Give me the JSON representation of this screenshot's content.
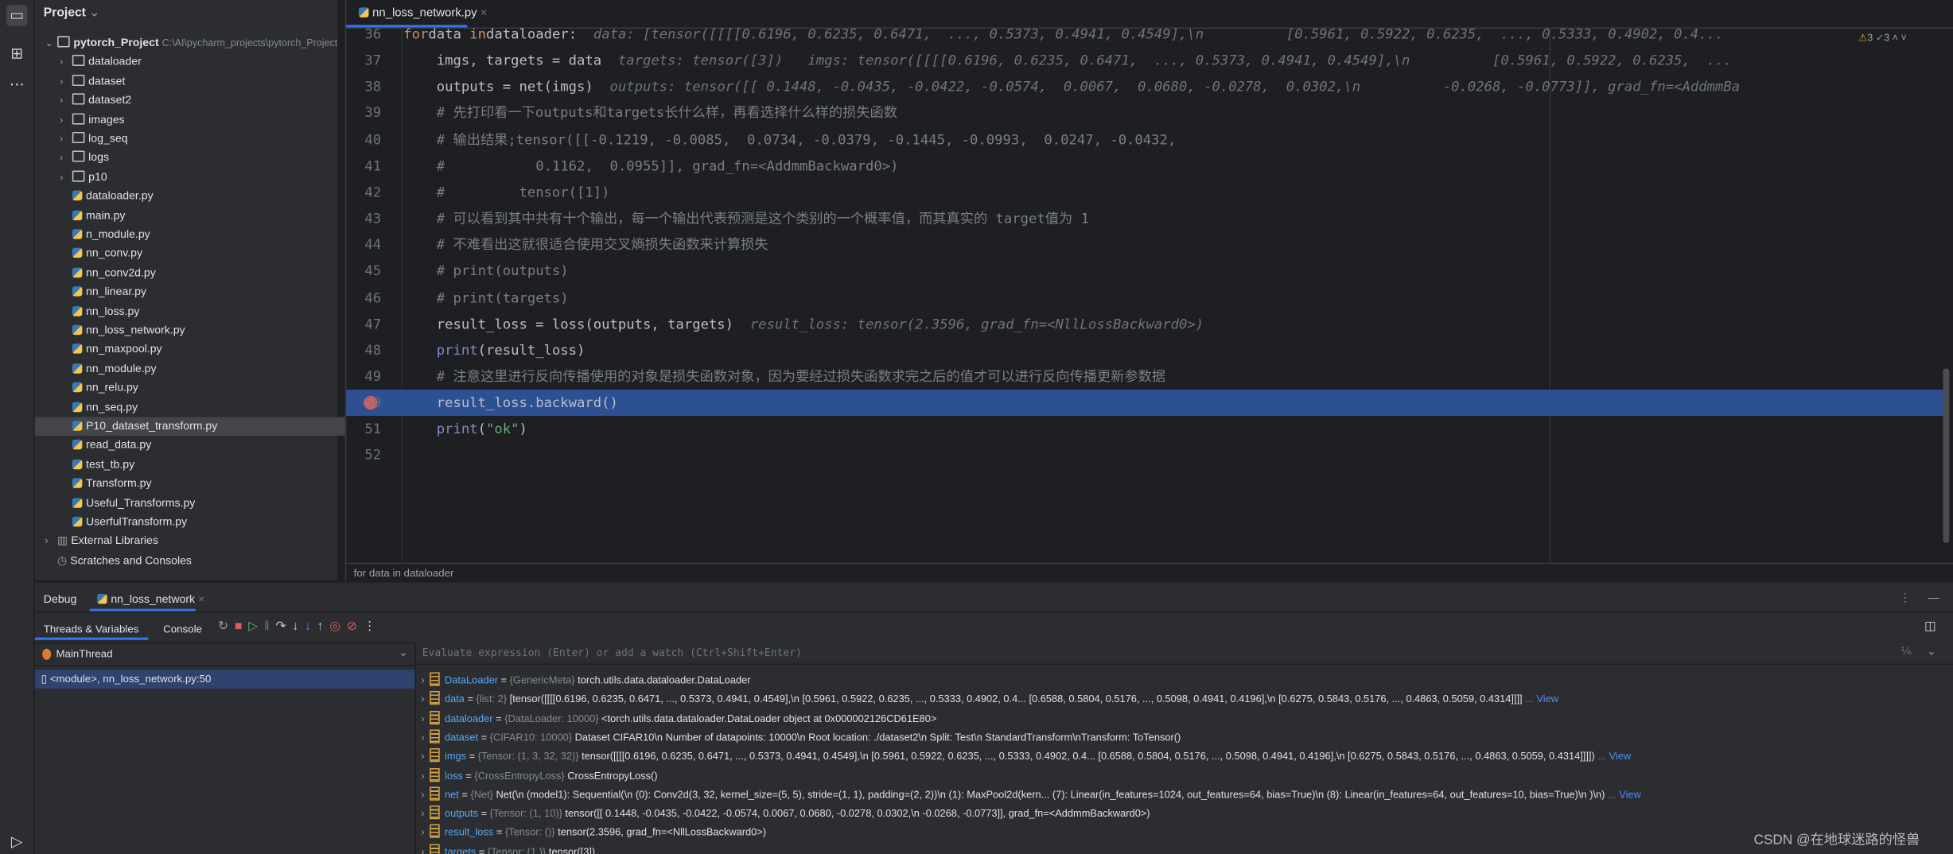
{
  "project": {
    "title": "Project",
    "root": "pytorch_Project",
    "root_path": "C:\\AI\\pycharm_projects\\pytorch_Project",
    "folders": [
      "dataloader",
      "dataset",
      "dataset2",
      "images",
      "log_seq",
      "logs",
      "p10"
    ],
    "files": [
      "dataloader.py",
      "main.py",
      "n_module.py",
      "nn_conv.py",
      "nn_conv2d.py",
      "nn_linear.py",
      "nn_loss.py",
      "nn_loss_network.py",
      "nn_maxpool.py",
      "nn_module.py",
      "nn_relu.py",
      "nn_seq.py",
      "P10_dataset_transform.py",
      "read_data.py",
      "test_tb.py",
      "Transform.py",
      "Useful_Transforms.py",
      "UserfulTransform.py"
    ],
    "selected": "P10_dataset_transform.py",
    "extra": [
      "External Libraries",
      "Scratches and Consoles"
    ]
  },
  "editor": {
    "tab": "nn_loss_network.py",
    "breadcrumb": "for data in dataloader",
    "inspections": {
      "warnings": "3",
      "ok": "3"
    },
    "current_line": 50,
    "breakpoint_line": 50,
    "lines": [
      {
        "n": "36",
        "seg": [
          [
            "kw",
            "for"
          ],
          [
            "",
            "data "
          ],
          [
            "kw",
            "in"
          ],
          [
            "",
            "dataloader:"
          ],
          [
            "hint",
            "  data: [tensor([[[[0.6196, 0.6235, 0.6471,  ..., 0.5373, 0.4941, 0.4549],\\n          [0.5961, 0.5922, 0.6235,  ..., 0.5333, 0.4902, 0.4..."
          ]
        ]
      },
      {
        "n": "37",
        "seg": [
          [
            "",
            "    imgs, targets = data"
          ],
          [
            "hint",
            "  targets: tensor([3])   imgs: tensor([[[[0.6196, 0.6235, 0.6471,  ..., 0.5373, 0.4941, 0.4549],\\n          [0.5961, 0.5922, 0.6235,  ..."
          ]
        ]
      },
      {
        "n": "38",
        "seg": [
          [
            "",
            "    outputs = net(imgs)"
          ],
          [
            "hint",
            "  outputs: tensor([[ 0.1448, -0.0435, -0.0422, -0.0574,  0.0067,  0.0680, -0.0278,  0.0302,\\n          -0.0268, -0.0773]], grad_fn=<AddmmBa"
          ]
        ]
      },
      {
        "n": "39",
        "seg": [
          [
            "cm",
            "    # 先打印看一下outputs和targets长什么样，再看选择什么样的损失函数"
          ]
        ]
      },
      {
        "n": "40",
        "seg": [
          [
            "cm",
            "    # 输出结果;tensor([[-0.1219, -0.0085,  0.0734, -0.0379, -0.1445, -0.0993,  0.0247, -0.0432,"
          ]
        ]
      },
      {
        "n": "41",
        "seg": [
          [
            "cm",
            "    #           0.1162,  0.0955]], grad_fn=<AddmmBackward0>)"
          ]
        ]
      },
      {
        "n": "42",
        "seg": [
          [
            "cm",
            "    #         tensor([1])"
          ]
        ]
      },
      {
        "n": "43",
        "seg": [
          [
            "cm",
            "    # 可以看到其中共有十个输出，每一个输出代表预测是这个类别的一个概率值，而其真实的 target值为 1"
          ]
        ]
      },
      {
        "n": "44",
        "seg": [
          [
            "cm",
            "    # 不难看出这就很适合使用交叉熵损失函数来计算损失"
          ]
        ]
      },
      {
        "n": "45",
        "seg": [
          [
            "cm",
            "    # print(outputs)"
          ]
        ]
      },
      {
        "n": "46",
        "seg": [
          [
            "cm",
            "    # print(targets)"
          ]
        ]
      },
      {
        "n": "47",
        "seg": [
          [
            "",
            "    result_loss = loss(outputs, targets)"
          ],
          [
            "hint",
            "  result_loss: tensor(2.3596, grad_fn=<NllLossBackward0>)"
          ]
        ]
      },
      {
        "n": "48",
        "seg": [
          [
            "bi",
            "    print"
          ],
          [
            "",
            "(result_loss)"
          ]
        ]
      },
      {
        "n": "49",
        "seg": [
          [
            "cm",
            "    # 注意这里进行反向传播使用的对象是损失函数对象，因为要经过损失函数求完之后的值才可以进行反向传播更新参数据"
          ]
        ]
      },
      {
        "n": "50",
        "seg": [
          [
            "",
            "    result_loss.backward()"
          ]
        ]
      },
      {
        "n": "51",
        "seg": [
          [
            "bi",
            "    print"
          ],
          [
            "",
            "("
          ],
          [
            "st",
            "\"ok\""
          ],
          [
            "",
            ")"
          ]
        ]
      },
      {
        "n": "52",
        "seg": []
      }
    ]
  },
  "debug": {
    "title": "Debug",
    "session_tab": "nn_loss_network",
    "tabs": [
      "Threads & Variables",
      "Console"
    ],
    "thread": "MainThread",
    "frame": "<module>, nn_loss_network.py:50",
    "eval_placeholder": "Evaluate expression (Enter) or add a watch (Ctrl+Shift+Enter)",
    "variables": [
      {
        "name": "DataLoader",
        "type": "{GenericMeta}",
        "value": "torch.utils.data.dataloader.DataLoader"
      },
      {
        "name": "data",
        "type": "{list: 2}",
        "value": "[tensor([[[[0.6196, 0.6235, 0.6471,  ..., 0.5373, 0.4941, 0.4549],\\n          [0.5961, 0.5922, 0.6235,  ..., 0.5333, 0.4902, 0.4...   [0.6588, 0.5804, 0.5176,  ..., 0.5098, 0.4941, 0.4196],\\n          [0.6275, 0.5843, 0.5176,  ..., 0.4863, 0.5059, 0.4314]]]]",
        "view": "... View"
      },
      {
        "name": "dataloader",
        "type": "{DataLoader: 10000}",
        "value": "<torch.utils.data.dataloader.DataLoader object at 0x000002126CD61E80>"
      },
      {
        "name": "dataset",
        "type": "{CIFAR10: 10000}",
        "value": "Dataset CIFAR10\\n    Number of datapoints: 10000\\n    Root location: ./dataset2\\n    Split: Test\\n    StandardTransform\\nTransform: ToTensor()"
      },
      {
        "name": "imgs",
        "type": "{Tensor: (1, 3, 32, 32)}",
        "value": "tensor([[[[0.6196, 0.6235, 0.6471,  ..., 0.5373, 0.4941, 0.4549],\\n          [0.5961, 0.5922, 0.6235,  ..., 0.5333, 0.4902, 0.4...   [0.6588, 0.5804, 0.5176,  ..., 0.5098, 0.4941, 0.4196],\\n          [0.6275, 0.5843, 0.5176,  ..., 0.4863, 0.5059, 0.4314]]]])",
        "view": "... View"
      },
      {
        "name": "loss",
        "type": "{CrossEntropyLoss}",
        "value": "CrossEntropyLoss()"
      },
      {
        "name": "net",
        "type": "{Net}",
        "value": "Net(\\n  (model1): Sequential(\\n    (0): Conv2d(3, 32, kernel_size=(5, 5), stride=(1, 1), padding=(2, 2))\\n    (1): MaxPool2d(kern...    (7): Linear(in_features=1024, out_features=64, bias=True)\\n    (8): Linear(in_features=64, out_features=10, bias=True)\\n  )\\n)",
        "view": "... View"
      },
      {
        "name": "outputs",
        "type": "{Tensor: (1, 10)}",
        "value": "tensor([[ 0.1448, -0.0435, -0.0422, -0.0574,  0.0067,  0.0680, -0.0278,  0.0302,\\n          -0.0268, -0.0773]], grad_fn=<AddmmBackward0>)"
      },
      {
        "name": "result_loss",
        "type": "{Tensor: ()}",
        "value": "tensor(2.3596, grad_fn=<NllLossBackward0>)"
      },
      {
        "name": "targets",
        "type": "{Tensor: (1,)}",
        "value": "tensor([3])"
      }
    ]
  },
  "watermark": "CSDN @在地球迷路的怪兽",
  "colors": {
    "accent": "#3574f0",
    "selection": "#2d5093",
    "breakpoint": "#db5c5c",
    "keyword": "#cf8e6d"
  }
}
